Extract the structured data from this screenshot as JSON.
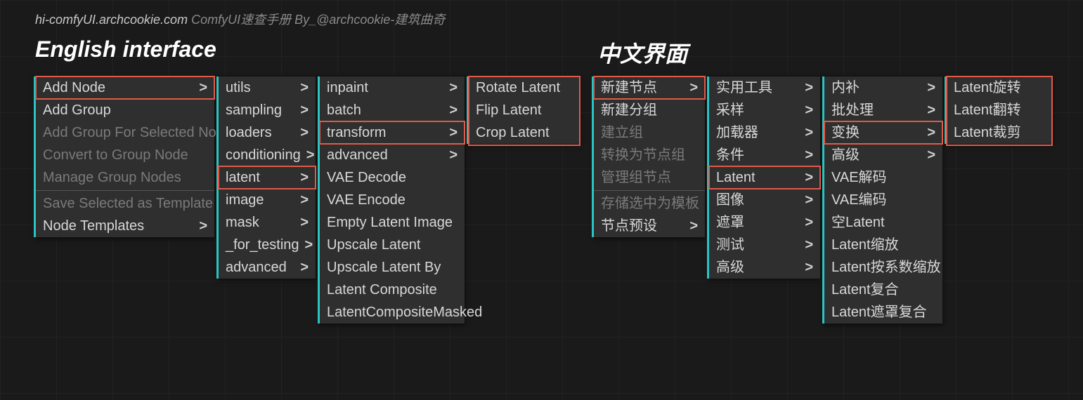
{
  "header": {
    "site": "hi-comfyUI.archcookie.com",
    "tagline": "ComfyUI速查手册  By_@archcookie-建筑曲奇"
  },
  "titles": {
    "en": "English interface",
    "cn": "中文界面"
  },
  "en": {
    "col1": [
      {
        "label": "Add Node",
        "arrow": true,
        "hl": true
      },
      {
        "label": "Add Group"
      },
      {
        "label": "Add Group For Selected Nodes",
        "dim": true
      },
      {
        "label": "Convert to Group Node",
        "dim": true
      },
      {
        "label": "Manage Group Nodes",
        "dim": true
      },
      {
        "sep": true
      },
      {
        "label": "Save Selected as Template",
        "dim": true
      },
      {
        "label": "Node Templates",
        "arrow": true
      }
    ],
    "col2": [
      {
        "label": "utils",
        "arrow": true
      },
      {
        "label": "sampling",
        "arrow": true
      },
      {
        "label": "loaders",
        "arrow": true
      },
      {
        "label": "conditioning",
        "arrow": true
      },
      {
        "label": "latent",
        "arrow": true,
        "hl": true
      },
      {
        "label": "image",
        "arrow": true
      },
      {
        "label": "mask",
        "arrow": true
      },
      {
        "label": "_for_testing",
        "arrow": true
      },
      {
        "label": "advanced",
        "arrow": true
      }
    ],
    "col3": [
      {
        "label": "inpaint",
        "arrow": true
      },
      {
        "label": "batch",
        "arrow": true
      },
      {
        "label": "transform",
        "arrow": true,
        "hl": true
      },
      {
        "label": "advanced",
        "arrow": true
      },
      {
        "label": "VAE Decode"
      },
      {
        "label": "VAE Encode"
      },
      {
        "label": "Empty Latent Image"
      },
      {
        "label": "Upscale Latent"
      },
      {
        "label": "Upscale Latent By"
      },
      {
        "label": "Latent Composite"
      },
      {
        "label": "LatentCompositeMasked"
      }
    ],
    "col4": [
      {
        "label": "Rotate Latent"
      },
      {
        "label": "Flip Latent"
      },
      {
        "label": "Crop Latent"
      }
    ]
  },
  "cn": {
    "col1": [
      {
        "label": "新建节点",
        "arrow": true,
        "hl": true
      },
      {
        "label": "新建分组"
      },
      {
        "label": "建立组",
        "dim": true
      },
      {
        "label": "转换为节点组",
        "dim": true
      },
      {
        "label": "管理组节点",
        "dim": true
      },
      {
        "sep": true
      },
      {
        "label": "存储选中为模板",
        "dim": true
      },
      {
        "label": "节点预设",
        "arrow": true
      }
    ],
    "col2": [
      {
        "label": "实用工具",
        "arrow": true
      },
      {
        "label": "采样",
        "arrow": true
      },
      {
        "label": "加载器",
        "arrow": true
      },
      {
        "label": "条件",
        "arrow": true
      },
      {
        "label": "Latent",
        "arrow": true,
        "hl": true
      },
      {
        "label": "图像",
        "arrow": true
      },
      {
        "label": "遮罩",
        "arrow": true
      },
      {
        "label": "测试",
        "arrow": true
      },
      {
        "label": "高级",
        "arrow": true
      }
    ],
    "col3": [
      {
        "label": "内补",
        "arrow": true
      },
      {
        "label": "批处理",
        "arrow": true
      },
      {
        "label": "变换",
        "arrow": true,
        "hl": true
      },
      {
        "label": "高级",
        "arrow": true
      },
      {
        "label": "VAE解码"
      },
      {
        "label": "VAE编码"
      },
      {
        "label": "空Latent"
      },
      {
        "label": "Latent缩放"
      },
      {
        "label": "Latent按系数缩放"
      },
      {
        "label": "Latent复合"
      },
      {
        "label": "Latent遮罩复合"
      }
    ],
    "col4": [
      {
        "label": "Latent旋转"
      },
      {
        "label": "Latent翻转"
      },
      {
        "label": "Latent裁剪"
      }
    ]
  },
  "colors": {
    "highlight": "#e05a4a",
    "accent": "#2bc4c4",
    "menu_bg": "#2f2f2f"
  }
}
